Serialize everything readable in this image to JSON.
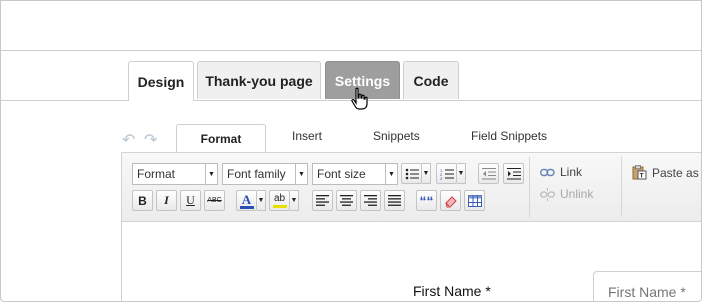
{
  "main_tabs": [
    {
      "label": "Design",
      "state": "active"
    },
    {
      "label": "Thank-you page",
      "state": "normal"
    },
    {
      "label": "Settings",
      "state": "hover"
    },
    {
      "label": "Code",
      "state": "normal"
    }
  ],
  "editor_tabs": [
    {
      "label": "Format",
      "state": "active"
    },
    {
      "label": "Insert",
      "state": "normal"
    },
    {
      "label": "Snippets",
      "state": "normal"
    },
    {
      "label": "Field Snippets",
      "state": "normal"
    }
  ],
  "toolbar": {
    "format_combo": "Format",
    "font_family_combo": "Font family",
    "font_size_combo": "Font size",
    "link_label": "Link",
    "unlink_label": "Unlink",
    "paste_label": "Paste as T",
    "bold": "B",
    "italic": "I",
    "underline": "U",
    "strikethrough": "ABC",
    "font_color": "A",
    "highlight": "ab",
    "blockquote": "““"
  },
  "icons": [
    "undo-icon",
    "redo-icon",
    "bullet-list-icon",
    "numbered-list-icon",
    "outdent-icon",
    "indent-icon",
    "eraser-icon",
    "table-icon",
    "link-icon",
    "unlink-icon",
    "paste-text-icon",
    "hand-pointer-icon"
  ],
  "form": {
    "first_name_label": "First Name *",
    "first_name_placeholder": "First Name *"
  },
  "colors": {
    "settings_hover": "#9e9e9e",
    "font_color_bar": "#2b4fb0",
    "highlight_bar": "#e8e000"
  }
}
